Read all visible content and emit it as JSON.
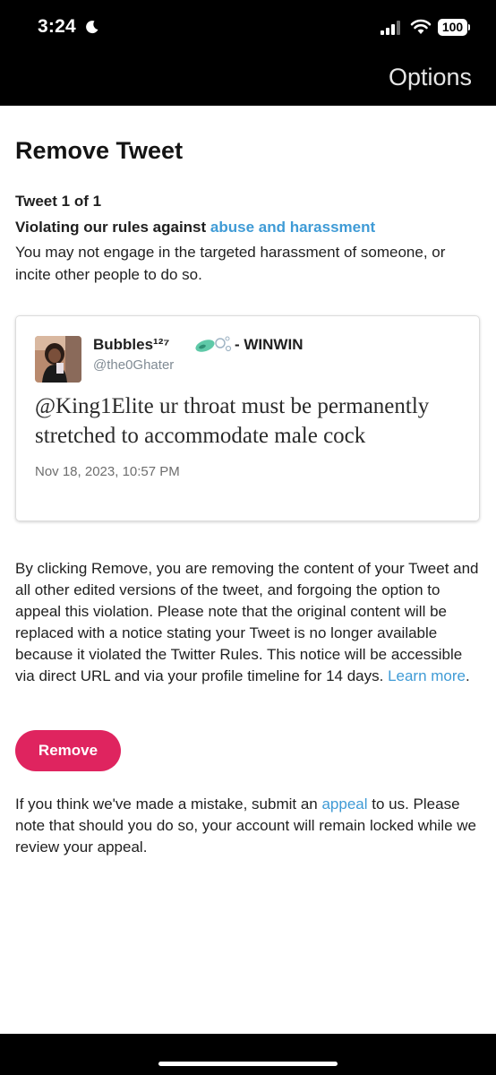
{
  "status_bar": {
    "time": "3:24",
    "battery": "100"
  },
  "nav": {
    "options_label": "Options"
  },
  "page": {
    "title": "Remove Tweet",
    "tweet_count": "Tweet 1 of 1",
    "violation_prefix": "Violating our rules against ",
    "violation_link": "abuse and harassment",
    "rule_description": "You may not engage in the targeted harassment of someone, or incite other people to do so."
  },
  "tweet": {
    "author_name": "Bubbles¹²⁷",
    "author_name_suffix": "- WINWIN",
    "author_handle": "@the0Ghater",
    "text": "@King1Elite ur throat must be permanently stretched to accommodate male cock",
    "timestamp": "Nov 18, 2023, 10:57 PM"
  },
  "removal_notice": {
    "text": "By clicking Remove, you are removing the content of your Tweet and all other edited versions of the tweet, and forgoing the option to appeal this violation. Please note that the original content will be replaced with a notice stating your Tweet is no longer available because it violated the Twitter Rules. This notice will be accessible via direct URL and via your profile timeline for 14 days. ",
    "learn_more_link": "Learn more",
    "end_punct": "."
  },
  "remove_button_label": "Remove",
  "appeal_notice": {
    "prefix": "If you think we've made a mistake, submit an ",
    "appeal_link": "appeal",
    "suffix": " to us. Please note that should you do so, your account will remain locked while we review your appeal."
  },
  "colors": {
    "link": "#3f9bd6",
    "remove_button": "#df245f",
    "status_bar_bg": "#000000"
  },
  "icons": [
    "moon-icon",
    "cellular-signal-icon",
    "wifi-icon",
    "battery-icon",
    "avatar-image",
    "bubble-emoji-icons"
  ]
}
